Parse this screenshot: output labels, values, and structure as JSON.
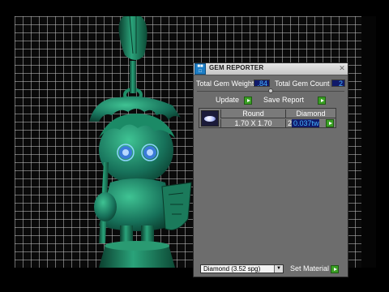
{
  "panel": {
    "title": "GEM REPORTER",
    "total_gem_weight_label": "Total Gem Weight",
    "total_gem_weight_value": ".84",
    "total_gem_count_label": "Total Gem Count",
    "total_gem_count_value": "2",
    "update_label": "Update",
    "save_report_label": "Save Report",
    "table": {
      "headers": [
        "Round",
        "Diamond"
      ],
      "rows": [
        {
          "size": "1.70 X 1.70",
          "count": "2",
          "weight": "0.037tw"
        }
      ]
    },
    "material_select": "Diamond    (3.52 spg)",
    "set_material_label": "Set Material"
  },
  "colors": {
    "figure": "#1a7f5f",
    "value_bg": "#101a6a",
    "value_text": "#46b4ff",
    "go_button": "#3aa024"
  },
  "icons": {
    "app": "gem-reporter-icon",
    "close": "close-icon",
    "go": "green-play-icon",
    "gem": "round-diamond-icon",
    "dropdown": "chevron-down-icon"
  }
}
